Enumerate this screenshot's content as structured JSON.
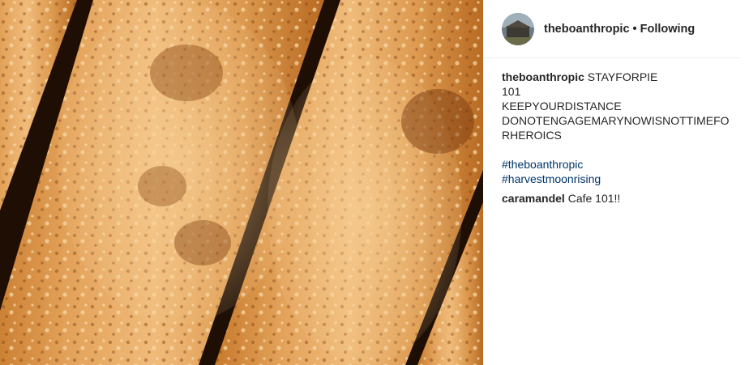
{
  "post": {
    "username": "theboanthropic",
    "follow_status": "Following",
    "separator": "•",
    "caption": {
      "username": "theboanthropic",
      "lines": [
        "STAYFORPIE",
        "101",
        "KEEPYOURDISTANCE",
        "DONOTENGAGEMARYNOWISNOTTIMEFO",
        "RHEROICS"
      ],
      "hashtags": [
        "#theboanthropic",
        "#harvestmoonrising"
      ]
    },
    "comment": {
      "username": "caramandel",
      "text": "Cafe 101!!"
    },
    "colors": {
      "hashtag": "#003569",
      "text": "#262626",
      "divider": "#efefef"
    },
    "icons": {
      "avatar": "avatar-image",
      "photo": "pie-crust-photo"
    }
  }
}
